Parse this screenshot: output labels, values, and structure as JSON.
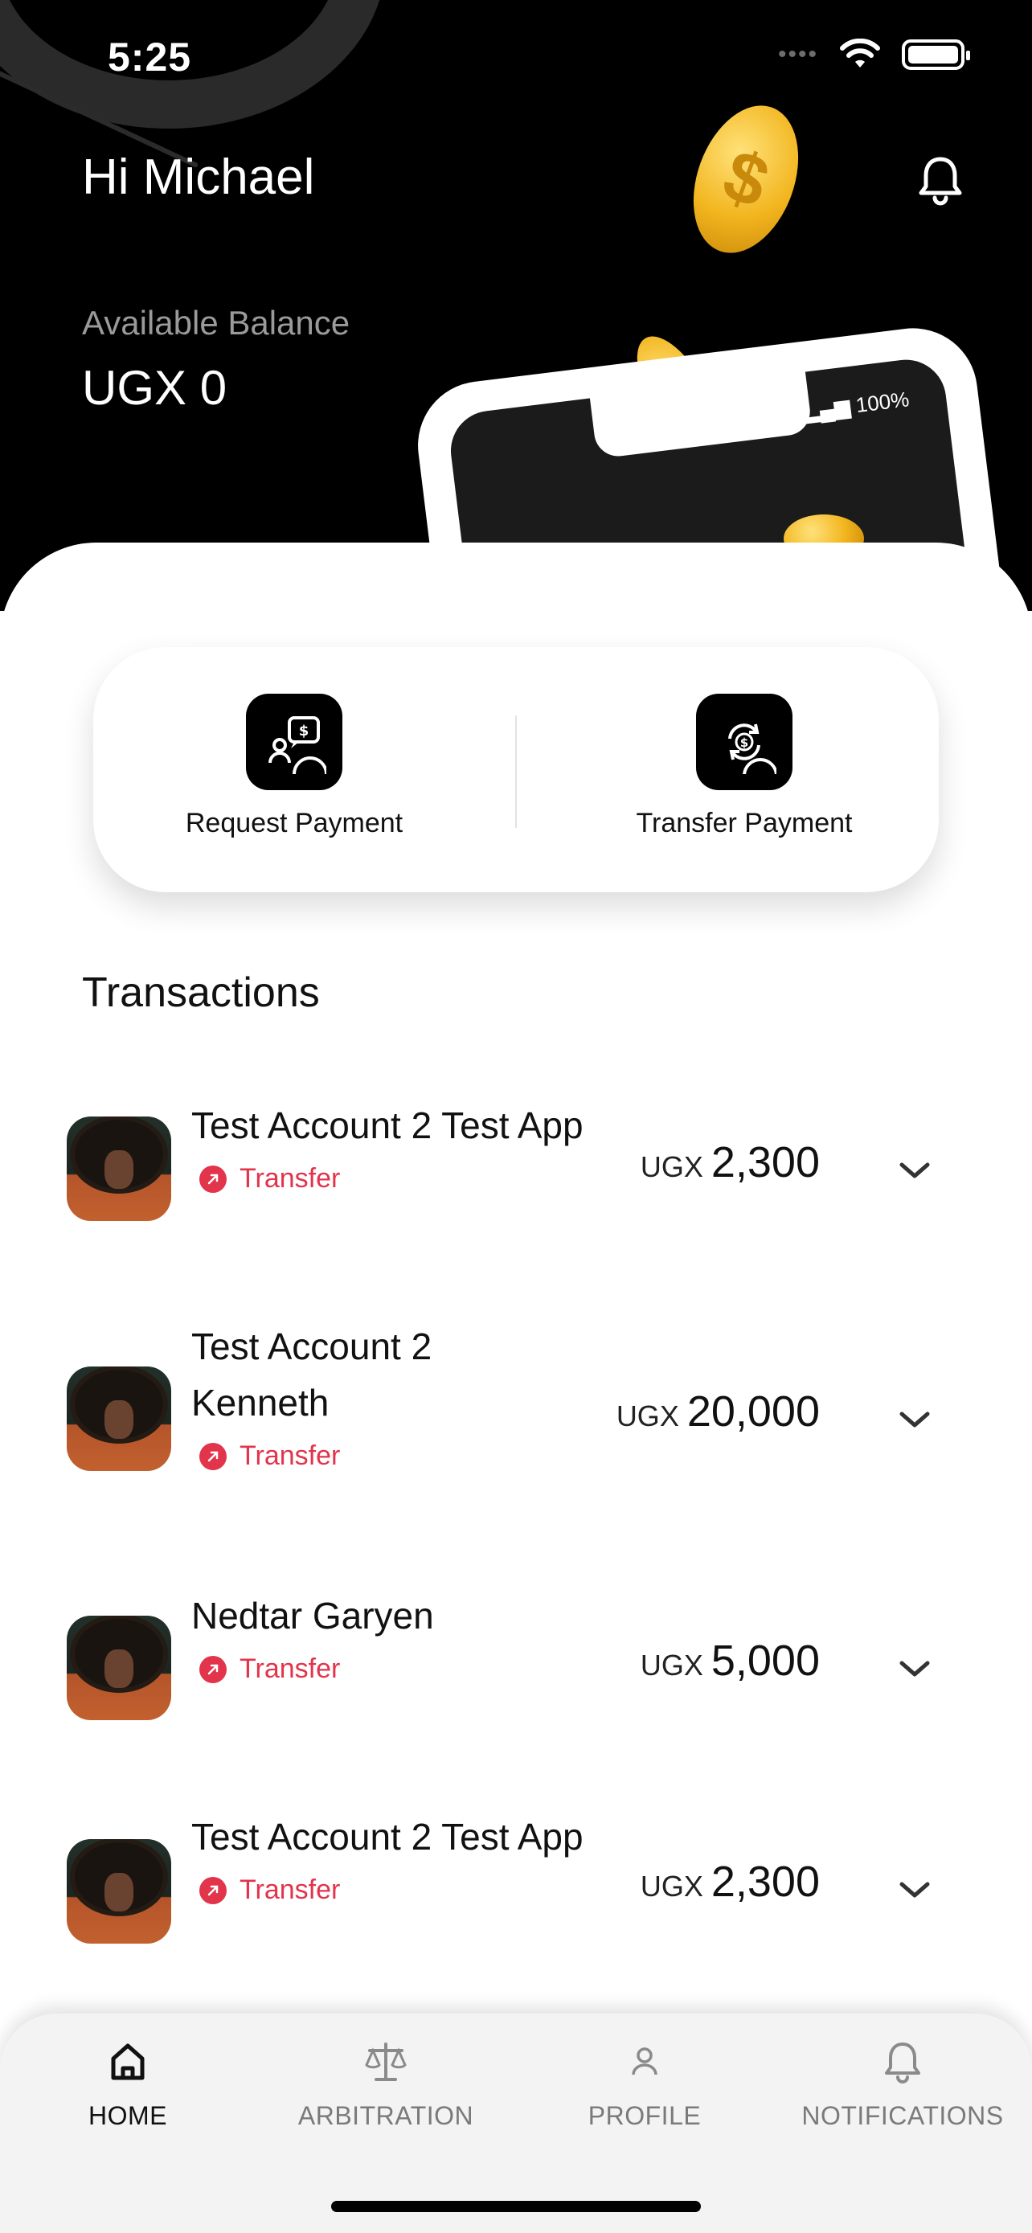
{
  "status_bar": {
    "time": "5:25",
    "dots": "••••"
  },
  "header": {
    "greeting": "Hi Michael",
    "balance_label": "Available Balance",
    "balance_value": "UGX 0",
    "illustration_status": "100%"
  },
  "actions": [
    {
      "label": "Request Payment",
      "icon": "request-payment-icon"
    },
    {
      "label": "Transfer Payment",
      "icon": "transfer-payment-icon"
    }
  ],
  "transactions": {
    "title": "Transactions",
    "items": [
      {
        "name_lines": [
          "Test Account 2 Test App"
        ],
        "type": "Transfer",
        "currency": "UGX",
        "amount": "2,300"
      },
      {
        "name_lines": [
          "Test Account 2",
          "Kenneth"
        ],
        "type": "Transfer",
        "currency": "UGX",
        "amount": "20,000"
      },
      {
        "name_lines": [
          "Nedtar Garyen"
        ],
        "type": "Transfer",
        "currency": "UGX",
        "amount": "5,000"
      },
      {
        "name_lines": [
          "Test Account 2 Test App"
        ],
        "type": "Transfer",
        "currency": "UGX",
        "amount": "2,300"
      }
    ]
  },
  "tabbar": {
    "items": [
      {
        "label": "HOME",
        "icon": "home-icon",
        "active": true
      },
      {
        "label": "ARBITRATION",
        "icon": "scales-icon",
        "active": false
      },
      {
        "label": "PROFILE",
        "icon": "person-icon",
        "active": false
      },
      {
        "label": "NOTIFICATIONS",
        "icon": "bell-icon",
        "active": false
      }
    ]
  },
  "colors": {
    "accent_red": "#e2344b",
    "hero_bg": "#000000",
    "coin_gold": "#f2b51e"
  }
}
